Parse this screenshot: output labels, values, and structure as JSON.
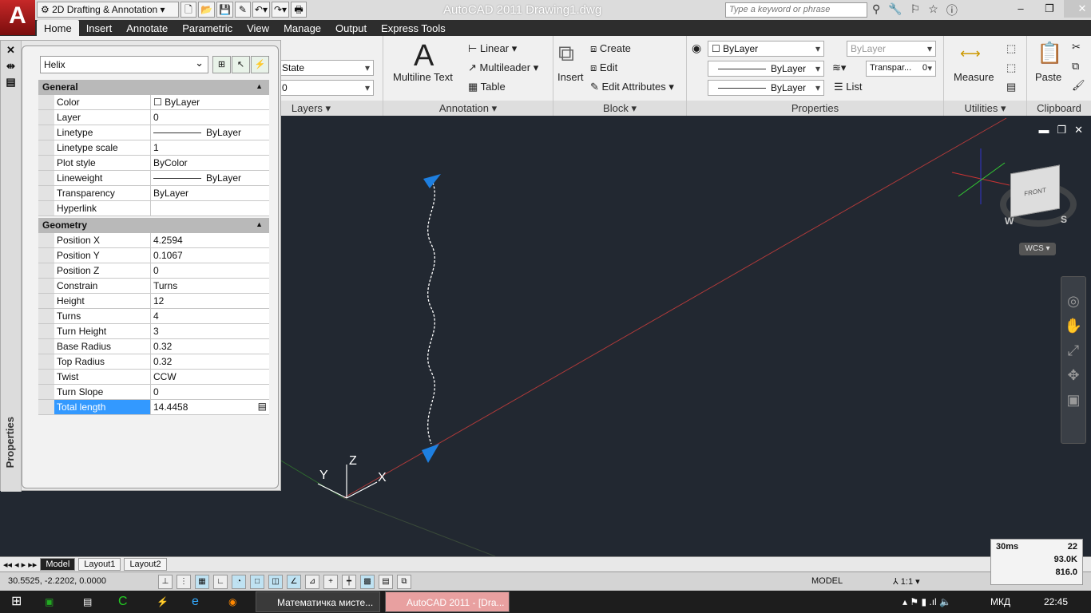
{
  "window": {
    "title": "AutoCAD 2011    Drawing1.dwg",
    "search_placeholder": "Type a keyword or phrase",
    "workspace": "2D Drafting & Annotation",
    "app_letter": "A"
  },
  "tabs": [
    "Home",
    "Insert",
    "Annotate",
    "Parametric",
    "View",
    "Manage",
    "Output",
    "Express Tools"
  ],
  "ribbon": {
    "layers": {
      "state": "State",
      "layer": "0",
      "title": "Layers"
    },
    "annotation": {
      "multiline_text": "Multiline Text",
      "linear": "Linear",
      "multileader": "Multileader",
      "table": "Table",
      "title": "Annotation"
    },
    "block": {
      "insert": "Insert",
      "create": "Create",
      "edit": "Edit",
      "edit_attributes": "Edit Attributes",
      "title": "Block"
    },
    "properties": {
      "color": "ByLayer",
      "lineweight": "ByLayer",
      "linetype": "ByLayer",
      "plot_style": "ByLayer",
      "transparency_label": "Transpar...",
      "transparency_value": "0",
      "list": "List",
      "title": "Properties"
    },
    "utilities": {
      "measure": "Measure",
      "title": "Utilities"
    },
    "clipboard": {
      "paste": "Paste",
      "title": "Clipboard"
    }
  },
  "palette": {
    "title": "Properties",
    "object": "Helix",
    "general": {
      "header": "General",
      "rows": [
        {
          "k": "Color",
          "v": "ByLayer"
        },
        {
          "k": "Layer",
          "v": "0"
        },
        {
          "k": "Linetype",
          "v": "ByLayer"
        },
        {
          "k": "Linetype scale",
          "v": "1"
        },
        {
          "k": "Plot style",
          "v": "ByColor"
        },
        {
          "k": "Lineweight",
          "v": "ByLayer"
        },
        {
          "k": "Transparency",
          "v": "ByLayer"
        },
        {
          "k": "Hyperlink",
          "v": ""
        }
      ]
    },
    "geometry": {
      "header": "Geometry",
      "rows": [
        {
          "k": "Position X",
          "v": "4.2594"
        },
        {
          "k": "Position Y",
          "v": "0.1067"
        },
        {
          "k": "Position Z",
          "v": "0"
        },
        {
          "k": "Constrain",
          "v": "Turns"
        },
        {
          "k": "Height",
          "v": "12"
        },
        {
          "k": "Turns",
          "v": "4"
        },
        {
          "k": "Turn Height",
          "v": "3"
        },
        {
          "k": "Base Radius",
          "v": "0.32"
        },
        {
          "k": "Top Radius",
          "v": "0.32"
        },
        {
          "k": "Twist",
          "v": "CCW"
        },
        {
          "k": "Turn Slope",
          "v": "0"
        },
        {
          "k": "Total length",
          "v": "14.4458"
        }
      ]
    }
  },
  "viewport": {
    "wcs": "WCS",
    "ucs_x": "X",
    "ucs_y": "Y",
    "ucs_z": "Z",
    "cube_face": "FRONT",
    "compass_w": "W",
    "compass_s": "S"
  },
  "layout_tabs": [
    "Model",
    "Layout1",
    "Layout2"
  ],
  "status": {
    "coords": "30.5525, -2.2202, 0.0000",
    "model": "MODEL",
    "scale": "1:1"
  },
  "perf": {
    "time": "30ms",
    "count": "22",
    "mem1": "93.0K",
    "mem2": "816.0"
  },
  "taskbar": {
    "app1": "Математичка мисте...",
    "app2": "AutoCAD 2011 - [Dra...",
    "lang": "МКД",
    "time": "22:45"
  },
  "colors": {
    "viewport_bg": "#222831",
    "helix": "#ffffff",
    "grip": "#1e7fe0",
    "x_axis": "#b03a3a",
    "selection": "#3399ff"
  }
}
